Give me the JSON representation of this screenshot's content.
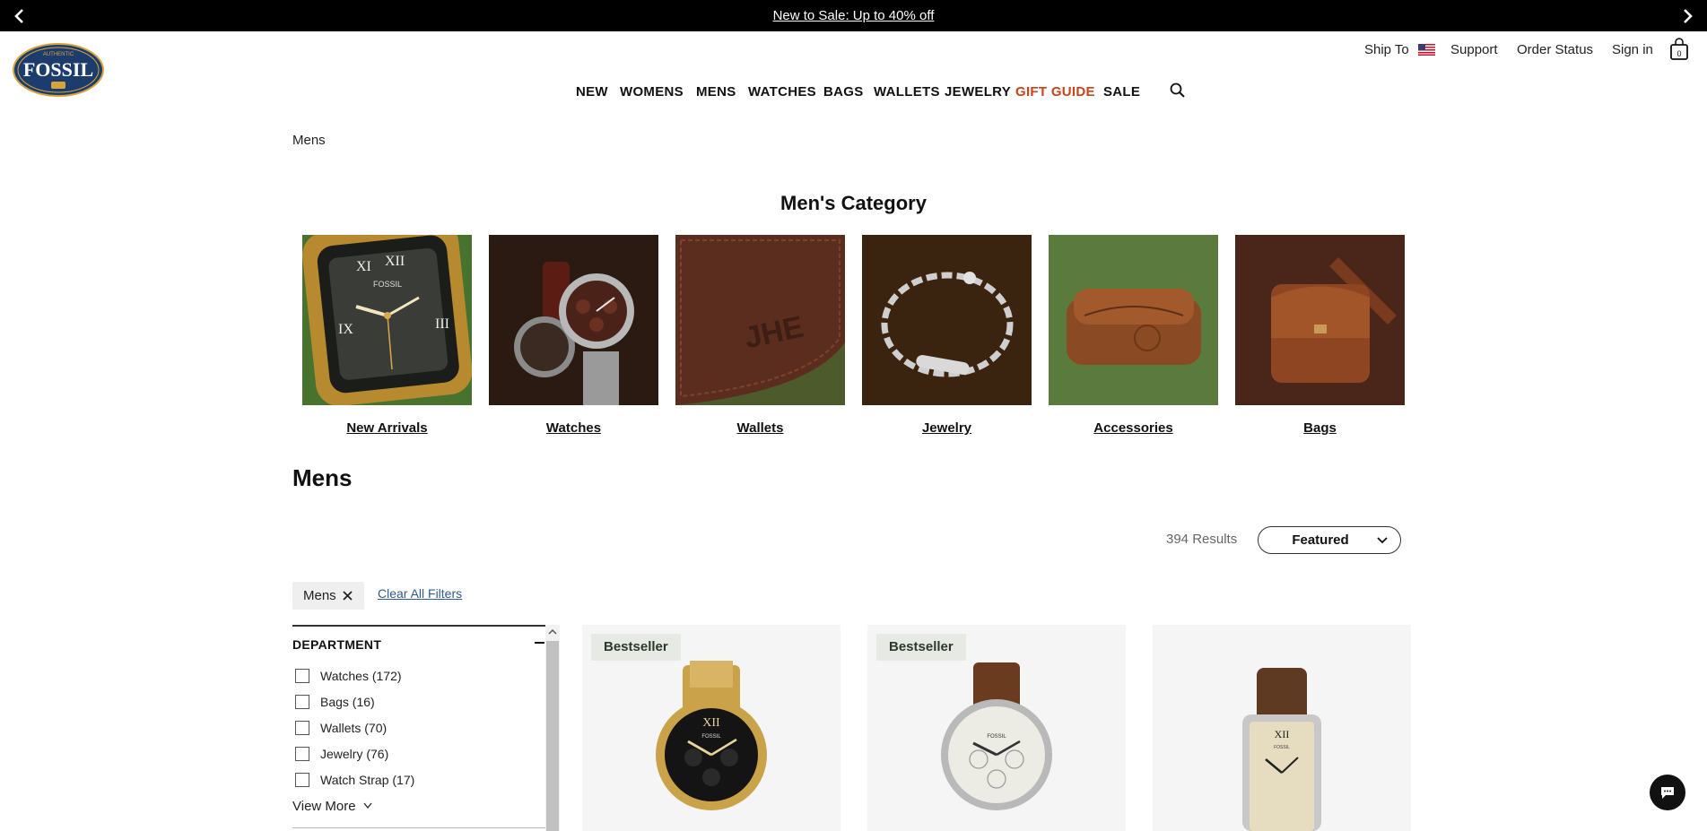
{
  "promo": {
    "message": "New to Sale: Up to 40% off"
  },
  "header": {
    "logo": {
      "icon": "fossil-logo",
      "text": "FOSSIL",
      "tagline": "AUTHENTIC"
    },
    "utility": {
      "ship_to": "Ship To",
      "support": "Support",
      "order_status": "Order Status",
      "sign_in": "Sign in",
      "cart_count": "0"
    },
    "nav": [
      "NEW",
      "WOMENS",
      "MENS",
      "WATCHES",
      "BAGS",
      "WALLETS",
      "JEWELRY",
      "GIFT GUIDE",
      "SALE"
    ],
    "nav_highlight_color": "#c9421a"
  },
  "breadcrumb": "Mens",
  "category_section": {
    "title": "Men's Category",
    "tiles": [
      {
        "label": "New Arrivals",
        "icon": "gold-square-watch-image"
      },
      {
        "label": "Watches",
        "icon": "chronograph-watches-image"
      },
      {
        "label": "Wallets",
        "icon": "leather-wallet-image"
      },
      {
        "label": "Jewelry",
        "icon": "chain-bracelet-image"
      },
      {
        "label": "Accessories",
        "icon": "leather-case-image"
      },
      {
        "label": "Bags",
        "icon": "leather-messenger-bag-image"
      }
    ]
  },
  "listing": {
    "title": "Mens",
    "results": "394 Results",
    "sort": "Featured",
    "active_filter": "Mens",
    "clear_all": "Clear All Filters"
  },
  "filters": {
    "department_title": "DEPARTMENT",
    "options": [
      "Watches (172)",
      "Bags (16)",
      "Wallets (70)",
      "Jewelry (76)",
      "Watch Strap (17)"
    ],
    "view_more": "View More"
  },
  "products": [
    {
      "badge": "Bestseller",
      "icon": "gold-chronograph-watch"
    },
    {
      "badge": "Bestseller",
      "icon": "brown-leather-chronograph-watch"
    },
    {
      "badge": "",
      "icon": "rectangular-brown-leather-watch"
    }
  ]
}
